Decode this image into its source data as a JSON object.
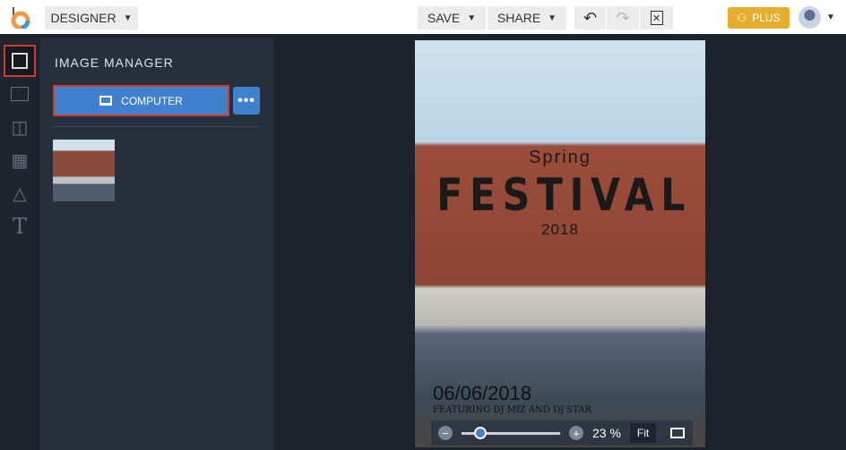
{
  "header": {
    "mode": "DESIGNER",
    "save": "SAVE",
    "share": "SHARE",
    "plus": "PLUS"
  },
  "panel": {
    "title": "IMAGE MANAGER",
    "computer": "COMPUTER",
    "more": "•••"
  },
  "poster": {
    "line1": "Spring",
    "line2": "FESTIVAL",
    "line3": "2018",
    "date": "06/06/2018",
    "featuring": "FEATURING DJ MIZ AND DJ STAR"
  },
  "zoom": {
    "value": "23 %",
    "fit": "Fit",
    "level_percent": 23
  }
}
